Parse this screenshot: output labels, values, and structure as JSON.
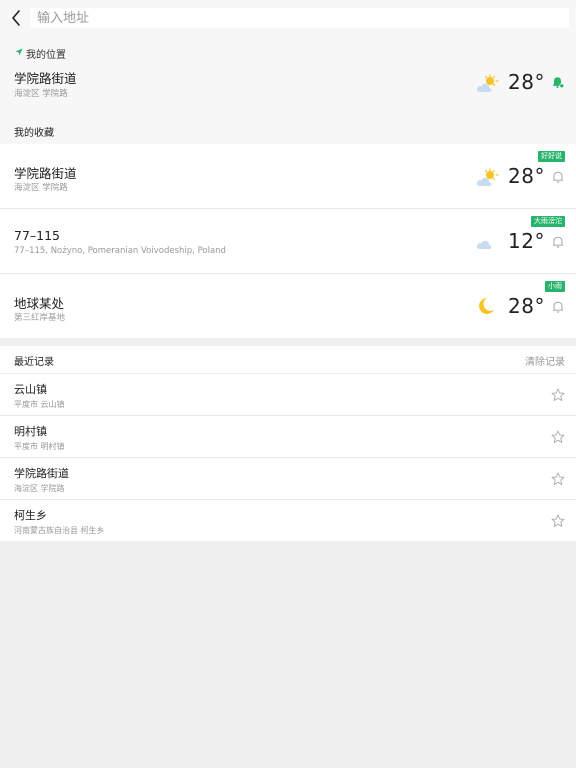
{
  "search": {
    "placeholder": "输入地址"
  },
  "my_location": {
    "label": "我的位置",
    "title": "学院路街道",
    "subtitle": "海淀区 学院路",
    "temperature": "28°",
    "weather_icon": "partly-sunny-icon"
  },
  "favorites": {
    "header": "我的收藏",
    "items": [
      {
        "title": "学院路街道",
        "subtitle": "海淀区 学院路",
        "temperature": "28°",
        "badge": "好好说",
        "weather_icon": "partly-sunny-icon"
      },
      {
        "title": "77–115",
        "subtitle": "77–115, Nożyno, Pomeranian Voivodeship, Poland",
        "temperature": "12°",
        "badge": "大雨滂沱",
        "weather_icon": "cloud-icon"
      },
      {
        "title": "地球某处",
        "subtitle": "第三红岸基地",
        "temperature": "28°",
        "badge": "小雨",
        "weather_icon": "moon-icon"
      }
    ]
  },
  "recent": {
    "header": "最近记录",
    "clear_label": "清除记录",
    "items": [
      {
        "title": "云山镇",
        "subtitle": "平度市 云山镇"
      },
      {
        "title": "明村镇",
        "subtitle": "平度市 明村镇"
      },
      {
        "title": "学院路街道",
        "subtitle": "海淀区 学院路"
      },
      {
        "title": "柯生乡",
        "subtitle": "河南蒙古族自治县 柯生乡"
      }
    ]
  },
  "colors": {
    "accent": "#26b36b",
    "background": "#efefef",
    "sun": "#f7c325",
    "cloud": "#c9dcef"
  }
}
